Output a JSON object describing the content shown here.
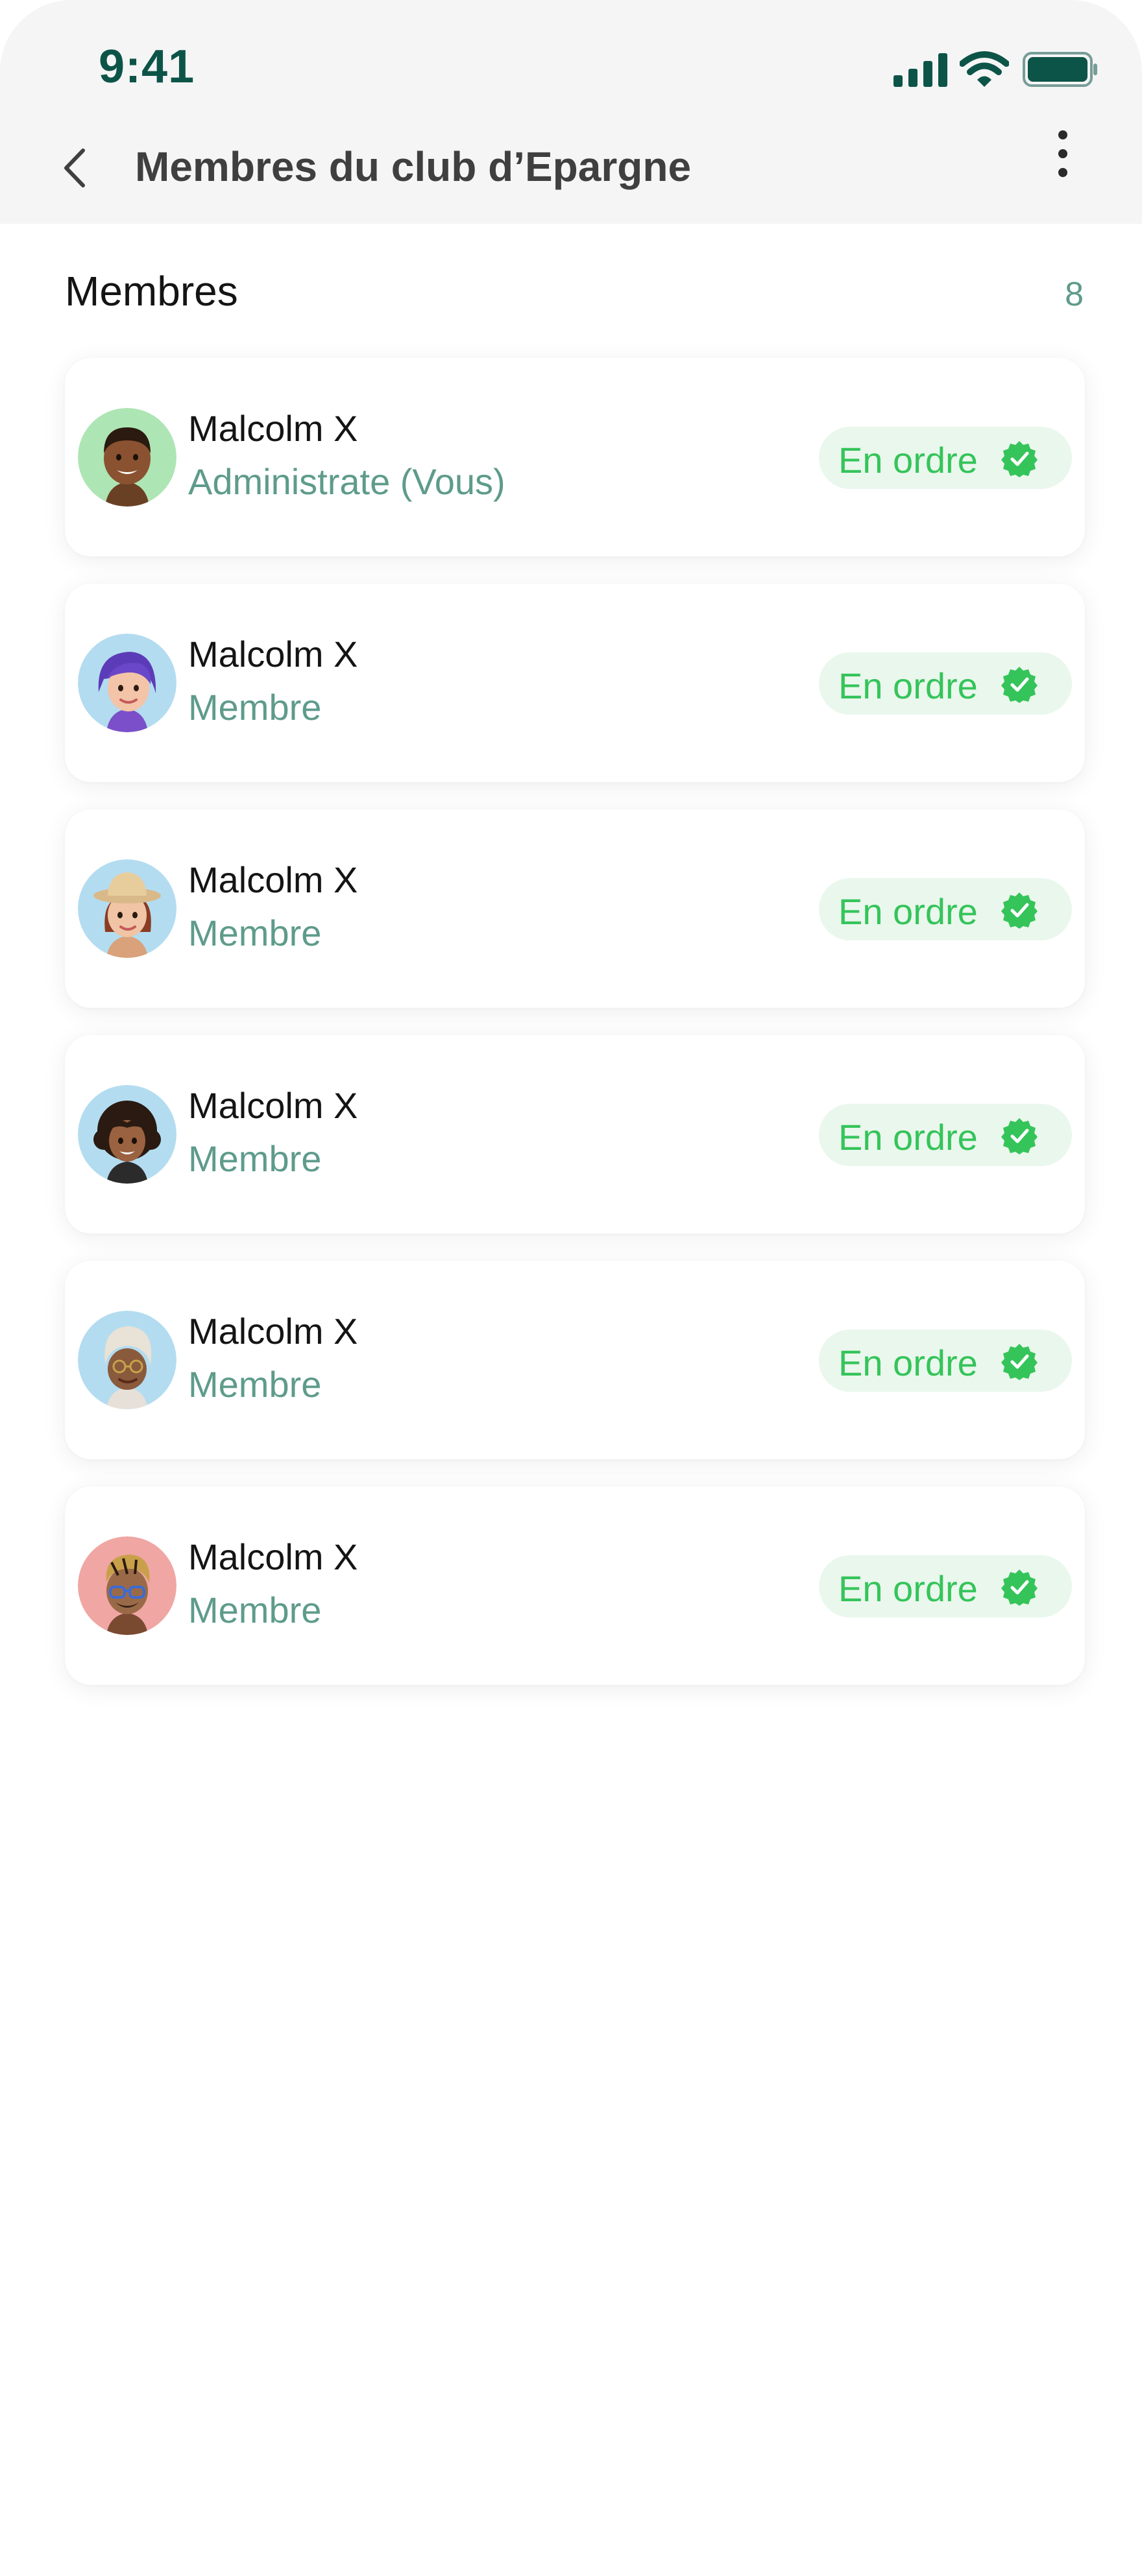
{
  "status_bar": {
    "time": "9:41"
  },
  "header": {
    "title": "Membres du club d’Epargne"
  },
  "section": {
    "title": "Membres",
    "count": "8"
  },
  "badge_color": "#35c45a",
  "members": [
    {
      "name": "Malcolm X",
      "role": "Administrate (Vous)",
      "status": "En ordre",
      "avatar_bg": "#aee5b4",
      "avatar": "man-avatar"
    },
    {
      "name": "Malcolm X",
      "role": "Membre",
      "status": "En ordre",
      "avatar_bg": "#b3dcf0",
      "avatar": "purple-hair-woman-avatar"
    },
    {
      "name": "Malcolm X",
      "role": "Membre",
      "status": "En ordre",
      "avatar_bg": "#b3dcf0",
      "avatar": "hat-woman-avatar"
    },
    {
      "name": "Malcolm X",
      "role": "Membre",
      "status": "En ordre",
      "avatar_bg": "#b3dcf0",
      "avatar": "curly-hair-woman-avatar"
    },
    {
      "name": "Malcolm X",
      "role": "Membre",
      "status": "En ordre",
      "avatar_bg": "#b3dcf0",
      "avatar": "headwrap-woman-avatar"
    },
    {
      "name": "Malcolm X",
      "role": "Membre",
      "status": "En ordre",
      "avatar_bg": "#f0a6a3",
      "avatar": "glasses-man-avatar"
    }
  ]
}
